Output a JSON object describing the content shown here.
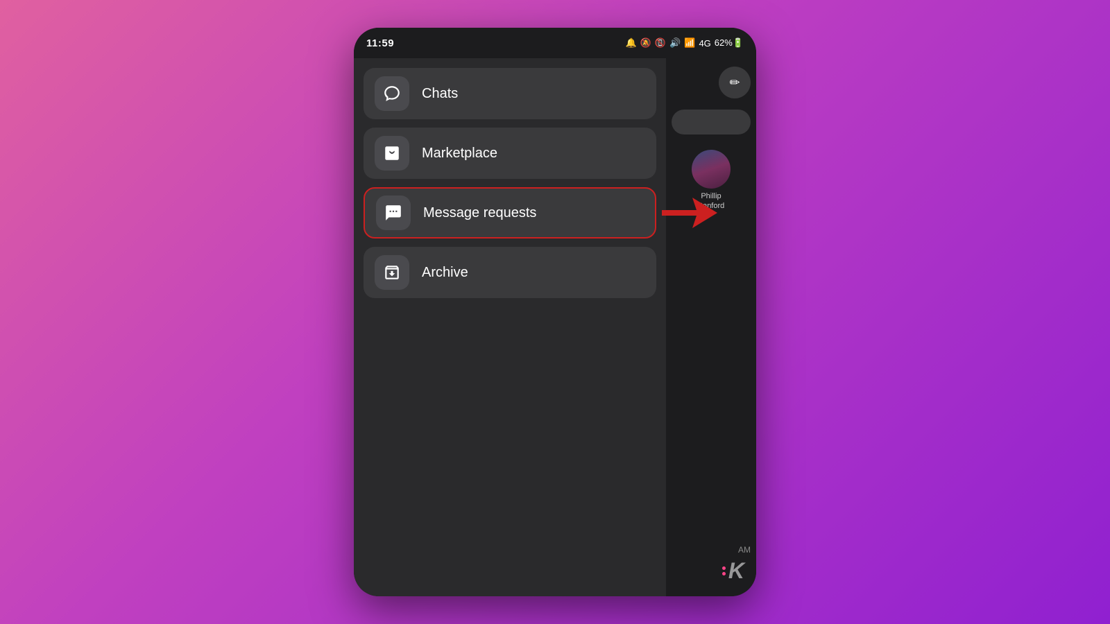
{
  "statusBar": {
    "time": "11:59",
    "icons": "🔋62%"
  },
  "menuItems": [
    {
      "id": "chats",
      "label": "Chats",
      "icon": "chat-bubble",
      "highlighted": false
    },
    {
      "id": "marketplace",
      "label": "Marketplace",
      "icon": "shop",
      "highlighted": false
    },
    {
      "id": "message-requests",
      "label": "Message requests",
      "icon": "message-dots",
      "highlighted": true
    },
    {
      "id": "archive",
      "label": "Archive",
      "icon": "archive",
      "highlighted": false
    }
  ],
  "rightPanel": {
    "avatar": {
      "names": [
        "Phillip",
        "Sanford"
      ],
      "nameLabel": "Phillip Sanford"
    },
    "timeLabel": "AM"
  },
  "compose": {
    "icon": "✏"
  },
  "watermark": {
    "k_label": "K"
  }
}
